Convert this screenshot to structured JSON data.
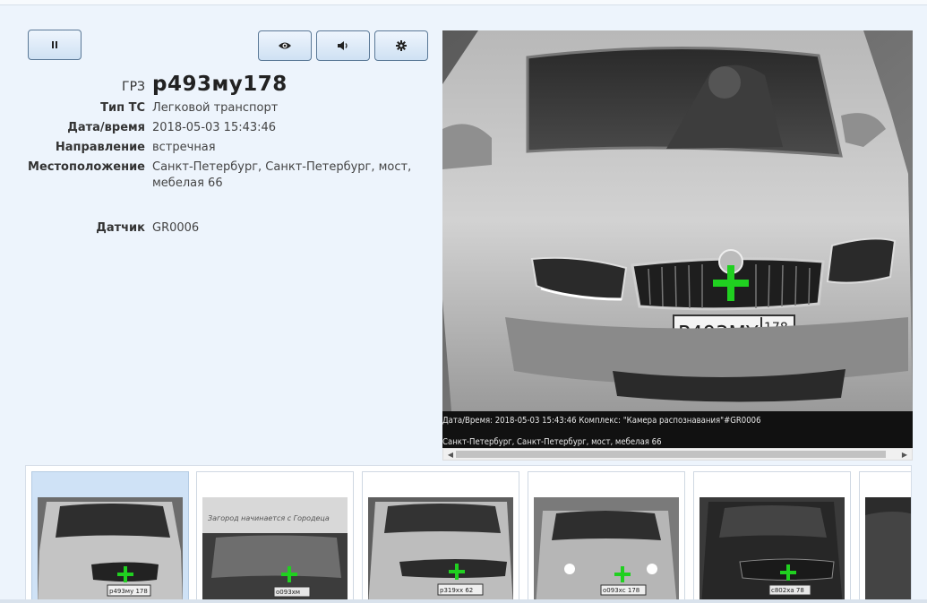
{
  "controls": {
    "pause": "pause-icon",
    "view": "eye-icon",
    "sound": "speaker-icon",
    "settings": "gear-icon"
  },
  "details": {
    "plate_label": "ГРЗ",
    "plate_value": "р493му178",
    "type_label": "Тип ТС",
    "type_value": "Легковой транспорт",
    "datetime_label": "Дата/время",
    "datetime_value": "2018-05-03 15:43:46",
    "direction_label": "Направление",
    "direction_value": "встречная",
    "location_label": "Местоположение",
    "location_value": "Санкт-Петербург, Санкт-Петербург, мост, мебелая 66",
    "sensor_label": "Датчик",
    "sensor_value": "GR0006"
  },
  "photo": {
    "plate_text": "P493MY",
    "plate_region": "178",
    "caption_line1": "Дата/Время: 2018-05-03 15:43:46  Комплекс: \"Камера распознавания\"#GR0006",
    "caption_line2": "Санкт-Петербург, Санкт-Петербург, мост, мебелая 66"
  },
  "thumbnails": [
    {
      "plate": "р493му 178",
      "selected": true
    },
    {
      "plate": "о093хм",
      "banner": "Загород начинается с Городеца",
      "selected": false
    },
    {
      "plate": "р319хх 62",
      "selected": false
    },
    {
      "plate": "о093хс 178",
      "selected": false
    },
    {
      "plate": "с802ха 78",
      "selected": false
    },
    {
      "plate": "",
      "selected": false
    }
  ],
  "colors": {
    "background": "#edf4fc",
    "button_border": "#5a7896",
    "crosshair": "#20d020",
    "selected_card": "#cfe2f6"
  }
}
